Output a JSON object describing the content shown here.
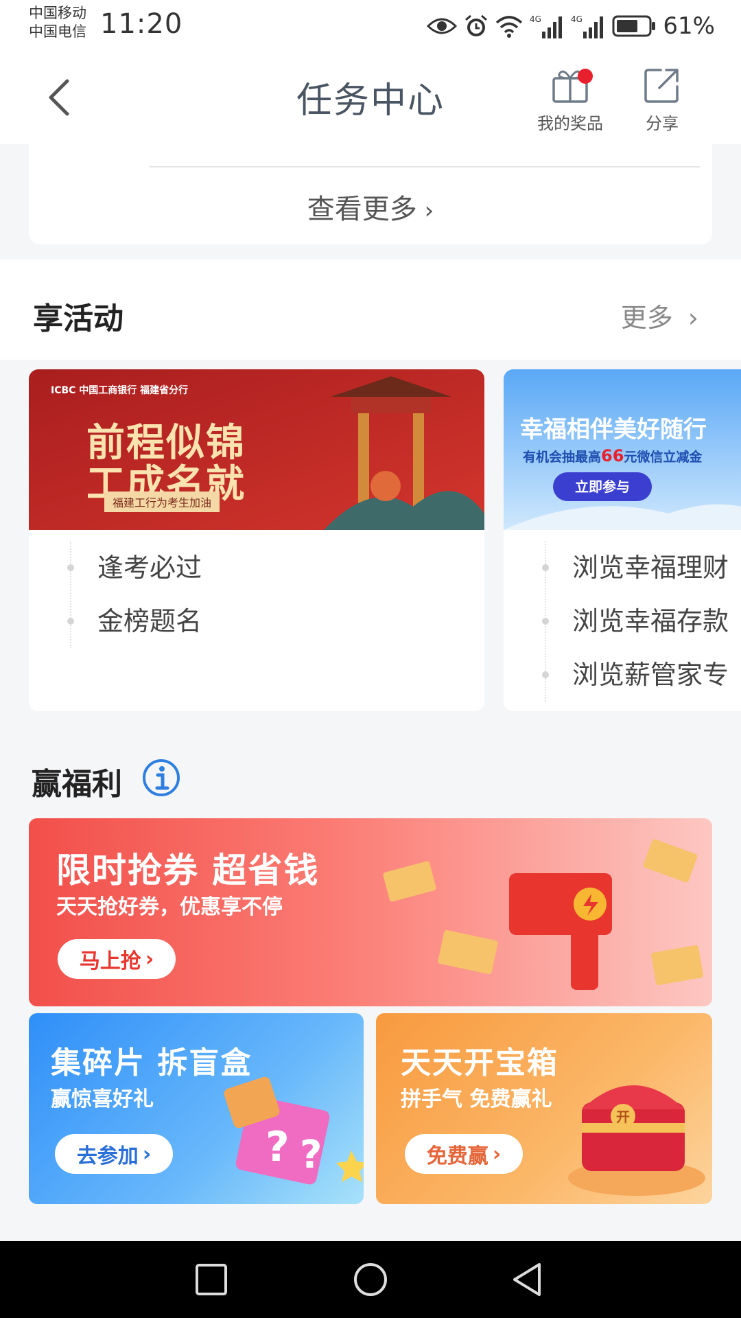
{
  "status_bar": {
    "carrier1": "中国移动",
    "carrier2": "中国电信",
    "time": "11:20",
    "battery": "61%",
    "icons": [
      "eye-icon",
      "alarm-icon",
      "wifi-icon",
      "signal-4g-icon",
      "signal-4g-icon",
      "battery-icon"
    ]
  },
  "nav": {
    "title": "任务中心",
    "prizes_label": "我的奖品",
    "share_label": "分享"
  },
  "top_card": {
    "see_more": "查看更多"
  },
  "activities": {
    "title": "享活动",
    "more": "更多",
    "cards": [
      {
        "banner": {
          "logo": "ICBC 中国工商银行 福建省分行",
          "headline1": "前程似锦",
          "headline2": "工成名就",
          "tag": "福建工行为考生加油",
          "colors": [
            "#a91e1e",
            "#d3352d"
          ]
        },
        "items": [
          "逢考必过",
          "金榜题名"
        ]
      },
      {
        "banner": {
          "headline": "幸福相伴美好随行",
          "sub_prefix": "有机会抽最高",
          "sub_number": "66",
          "sub_suffix": "元微信立减金",
          "button": "立即参与"
        },
        "items": [
          "浏览幸福理财",
          "浏览幸福存款",
          "浏览薪管家专"
        ]
      }
    ]
  },
  "welfare": {
    "title": "赢福利",
    "banners": [
      {
        "title": "限时抢券 超省钱",
        "subtitle": "天天抢好券，优惠享不停",
        "button": "马上抢"
      },
      {
        "title": "集碎片 拆盲盒",
        "subtitle": "赢惊喜好礼",
        "button": "去参加"
      },
      {
        "title": "天天开宝箱",
        "subtitle": "拼手气 免费赢礼",
        "button": "免费赢",
        "chest_label": "开"
      }
    ]
  },
  "accent_colors": {
    "red_dot": "#e8202d",
    "blue": "#2f8ff8",
    "orange": "#f89a3f"
  }
}
